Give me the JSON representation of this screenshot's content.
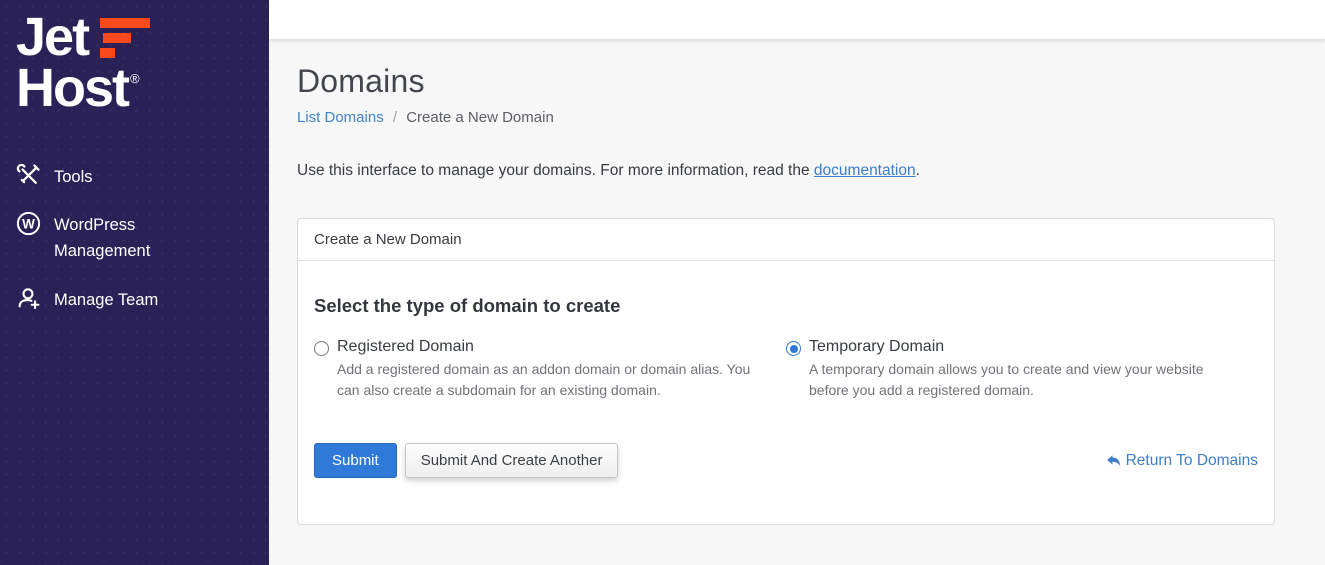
{
  "brand": {
    "line1": "Jet",
    "line2": "Host",
    "registered_mark": "®"
  },
  "sidebar": {
    "items": [
      {
        "label": "Tools",
        "icon": "tools-icon"
      },
      {
        "label": "WordPress Management",
        "icon": "wordpress-icon"
      },
      {
        "label": "Manage Team",
        "icon": "add-user-icon"
      }
    ]
  },
  "page": {
    "title": "Domains",
    "breadcrumb": {
      "link": "List Domains",
      "separator": "/",
      "current": "Create a New Domain"
    },
    "intro": {
      "before_link": "Use this interface to manage your domains. For more information, read the ",
      "link": "documentation",
      "after_link": "."
    }
  },
  "panel": {
    "header": "Create a New Domain",
    "section_title": "Select the type of domain to create",
    "options": [
      {
        "label": "Registered Domain",
        "selected": false,
        "description": "Add a registered domain as an addon domain or domain alias. You can also create a subdomain for an existing domain."
      },
      {
        "label": "Temporary Domain",
        "selected": true,
        "description": "A temporary domain allows you to create and view your website before you add a registered domain."
      }
    ],
    "buttons": {
      "submit": "Submit",
      "submit_and_create_another": "Submit And Create Another"
    },
    "return_link": "Return To Domains"
  },
  "colors": {
    "sidebar_bg": "#2a2157",
    "accent_orange": "#f94a1d",
    "link_blue": "#3d7dca",
    "primary_button": "#2f7ad8",
    "radio_selected": "#2f7bd9",
    "content_bg": "#f7f7f8"
  }
}
